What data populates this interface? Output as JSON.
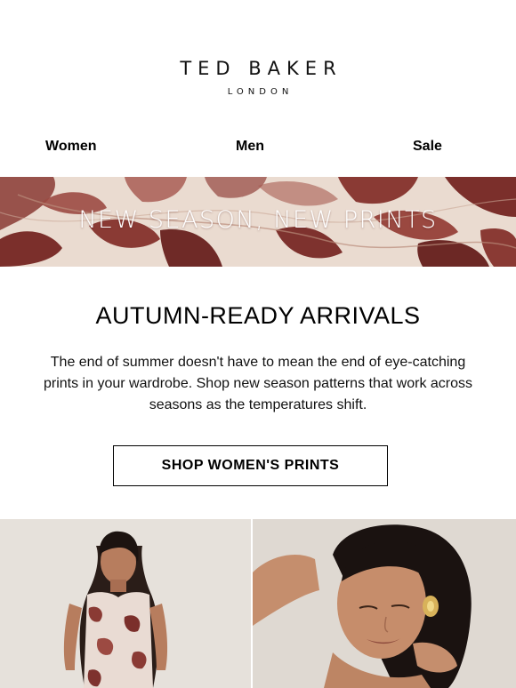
{
  "brand": {
    "name": "TED BAKER",
    "subtitle": "LONDON"
  },
  "nav": {
    "items": [
      "Women",
      "Men",
      "Sale"
    ]
  },
  "banner": {
    "text": "NEW SEASON, NEW PRINTS",
    "colors": {
      "background": "#e9d8cd",
      "leaf": "#8a3a34",
      "text": "#ffffff"
    }
  },
  "content": {
    "headline": "AUTUMN-READY ARRIVALS",
    "body": "The end of summer doesn't have to mean the end of eye-catching prints in your wardrobe. Shop new season patterns that work across seasons as the temperatures shift.",
    "cta_label": "SHOP WOMEN'S PRINTS"
  },
  "images": {
    "left": "model-in-printed-slip-dress",
    "right": "model-with-gold-earring"
  }
}
